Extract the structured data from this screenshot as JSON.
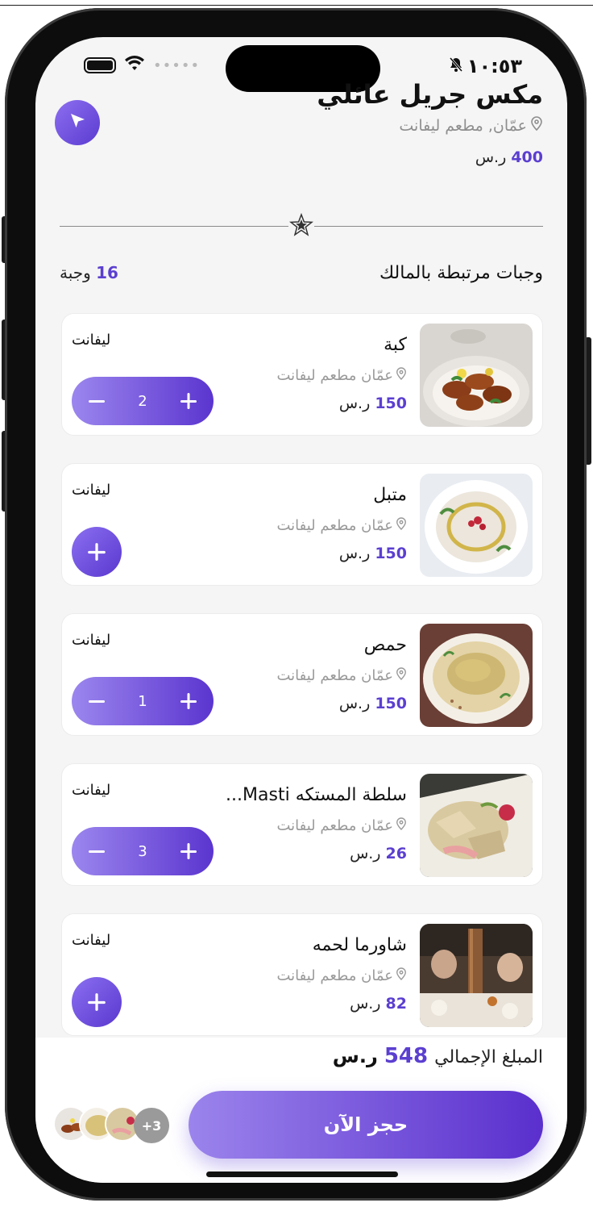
{
  "status": {
    "time": "١٠:٥٣",
    "mute_icon": "bell-slash-icon"
  },
  "header": {
    "title": "مكس جريل عائلي",
    "location": "عمّان, مطعم ليفانت",
    "price_value": "400",
    "currency": "ر.س"
  },
  "section": {
    "title": "وجبات مرتبطة بالمالك",
    "count_value": "16",
    "count_unit": "وجبة"
  },
  "items": [
    {
      "name": "كبة",
      "location": "عمّان مطعم ليفانت",
      "price": "150",
      "currency": "ر.س",
      "tag": "ليفانت",
      "quantity": "2"
    },
    {
      "name": "متبل",
      "location": "عمّان مطعم ليفانت",
      "price": "150",
      "currency": "ر.س",
      "tag": "ليفانت",
      "quantity": null
    },
    {
      "name": "حمص",
      "location": "عمّان مطعم ليفانت",
      "price": "150",
      "currency": "ر.س",
      "tag": "ليفانت",
      "quantity": "1"
    },
    {
      "name": "سلطة المستكه Masti...",
      "location": "عمّان مطعم ليفانت",
      "price": "26",
      "currency": "ر.س",
      "tag": "ليفانت",
      "quantity": "3"
    },
    {
      "name": "شاورما لحمه",
      "location": "عمّان مطعم ليفانت",
      "price": "82",
      "currency": "ر.س",
      "tag": "ليفانت",
      "quantity": null
    }
  ],
  "footer": {
    "total_label": "المبلغ الإجمالي",
    "total_value": "548",
    "total_currency": "ر.س",
    "book_label": "حجز الآن",
    "more_badge": "+3"
  },
  "colors": {
    "accent": "#5b3fd0",
    "accent_light": "#9b84ec"
  }
}
